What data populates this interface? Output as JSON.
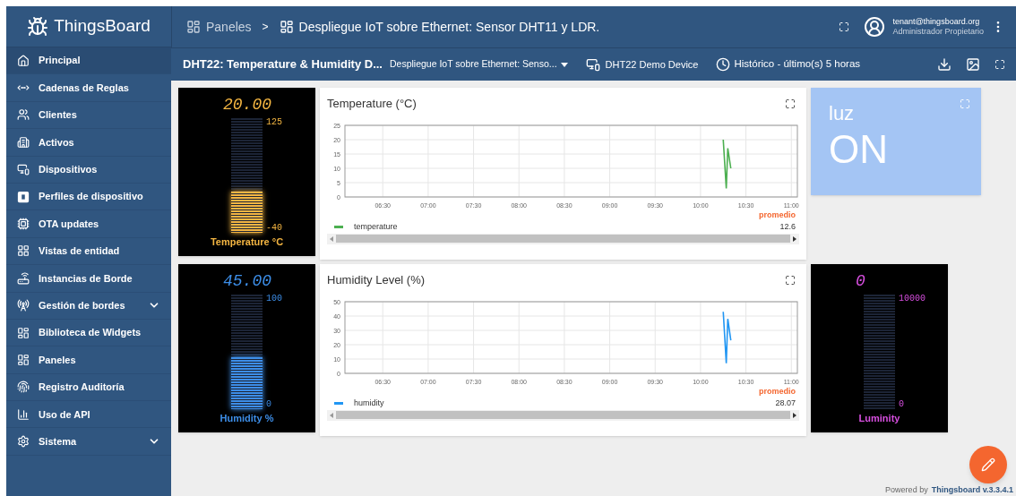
{
  "header": {
    "logo": "ThingsBoard",
    "separator": ">",
    "breadcrumbs": [
      {
        "label": "Paneles"
      },
      {
        "label": "Despliegue IoT sobre Ethernet: Sensor DHT11 y LDR."
      }
    ],
    "user": {
      "email": "tenant@thingsboard.org",
      "role": "Administrador Propietario"
    }
  },
  "toolbar": {
    "dashboard_title": "DHT22: Temperature & Humidity D...",
    "state_select": "Despliegue IoT sobre Ethernet: Senso...",
    "entity": "DHT22 Demo Device",
    "timewindow": "Histórico - último(s) 5 horas"
  },
  "sidebar": {
    "items": [
      {
        "label": "Principal",
        "kind": "link",
        "selected": true
      },
      {
        "label": "Cadenas de Reglas",
        "kind": "link",
        "selected": false
      },
      {
        "label": "Clientes",
        "kind": "link",
        "selected": false
      },
      {
        "label": "Activos",
        "kind": "link",
        "selected": false
      },
      {
        "label": "Dispositivos",
        "kind": "link",
        "selected": false
      },
      {
        "label": "Perfiles de dispositivo",
        "kind": "link",
        "selected": false
      },
      {
        "label": "OTA updates",
        "kind": "link",
        "selected": false
      },
      {
        "label": "Vistas de entidad",
        "kind": "link",
        "selected": false
      },
      {
        "label": "Instancias de Borde",
        "kind": "link",
        "selected": false
      },
      {
        "label": "Gestión de bordes",
        "kind": "group",
        "selected": false
      },
      {
        "label": "Biblioteca de Widgets",
        "kind": "link",
        "selected": false
      },
      {
        "label": "Paneles",
        "kind": "link",
        "selected": false
      },
      {
        "label": "Registro Auditoría",
        "kind": "link",
        "selected": false
      },
      {
        "label": "Uso de API",
        "kind": "link",
        "selected": false
      },
      {
        "label": "Sistema",
        "kind": "group",
        "selected": false
      }
    ]
  },
  "widget_rows": [
    [
      {
        "kind": "gauge",
        "value": "20.00",
        "max": "125",
        "min": "-40",
        "label": "Temperature °C",
        "level": 0.36,
        "color": "#f5b642"
      },
      {
        "kind": "chart",
        "title": "Temperature (°C)",
        "legend_header": "promedio",
        "legend": [
          {
            "value": "12.6"
          }
        ],
        "chart_data": {
          "type": "line",
          "grid": true,
          "x": [
            615,
            617,
            618,
            620
          ],
          "series": [
            {
              "name": "temperature",
              "color": "#4caf50",
              "values": [
                20,
                3,
                17,
                10
              ]
            }
          ],
          "xlim": [
            365,
            664
          ],
          "ylim": [
            0,
            25
          ],
          "yticks": [
            0,
            5,
            10,
            15,
            20,
            25
          ],
          "xticks": [
            {
              "value": 390,
              "label": "06:30"
            },
            {
              "value": 420,
              "label": "07:00"
            },
            {
              "value": 450,
              "label": "07:30"
            },
            {
              "value": 480,
              "label": "08:00"
            },
            {
              "value": 510,
              "label": "08:30"
            },
            {
              "value": 540,
              "label": "09:00"
            },
            {
              "value": 570,
              "label": "09:30"
            },
            {
              "value": 600,
              "label": "10:00"
            },
            {
              "value": 630,
              "label": "10:30"
            },
            {
              "value": 660,
              "label": "11:00"
            }
          ]
        }
      },
      {
        "kind": "status",
        "title": "luz",
        "value": "ON"
      }
    ],
    [
      {
        "kind": "gauge",
        "value": "45.00",
        "max": "100",
        "min": "0",
        "label": "Humidity %",
        "level": 0.45,
        "color": "#3d8ee8"
      },
      {
        "kind": "chart",
        "title": "Humidity Level (%)",
        "legend_header": "promedio",
        "legend": [
          {
            "value": "28.07"
          }
        ],
        "chart_data": {
          "type": "line",
          "grid": true,
          "x": [
            615,
            617,
            618,
            620
          ],
          "series": [
            {
              "name": "humidity",
              "color": "#2196f3",
              "values": [
                43,
                7,
                38,
                23
              ]
            }
          ],
          "xlim": [
            365,
            664
          ],
          "ylim": [
            0,
            50
          ],
          "yticks": [
            0,
            10,
            20,
            30,
            40,
            50
          ],
          "xticks": [
            {
              "value": 390,
              "label": "06:30"
            },
            {
              "value": 420,
              "label": "07:00"
            },
            {
              "value": 450,
              "label": "07:30"
            },
            {
              "value": 480,
              "label": "08:00"
            },
            {
              "value": 510,
              "label": "08:30"
            },
            {
              "value": 540,
              "label": "09:00"
            },
            {
              "value": 570,
              "label": "09:30"
            },
            {
              "value": 600,
              "label": "10:00"
            },
            {
              "value": 630,
              "label": "10:30"
            },
            {
              "value": 660,
              "label": "11:00"
            }
          ]
        }
      },
      {
        "kind": "gauge",
        "value": "0",
        "max": "10000",
        "min": "0",
        "label": "Luminity",
        "level": 0,
        "color": "#d84fe0"
      }
    ]
  ],
  "footer": {
    "text": "Powered by",
    "link": "Thingsboard v.3.3.4.1"
  }
}
